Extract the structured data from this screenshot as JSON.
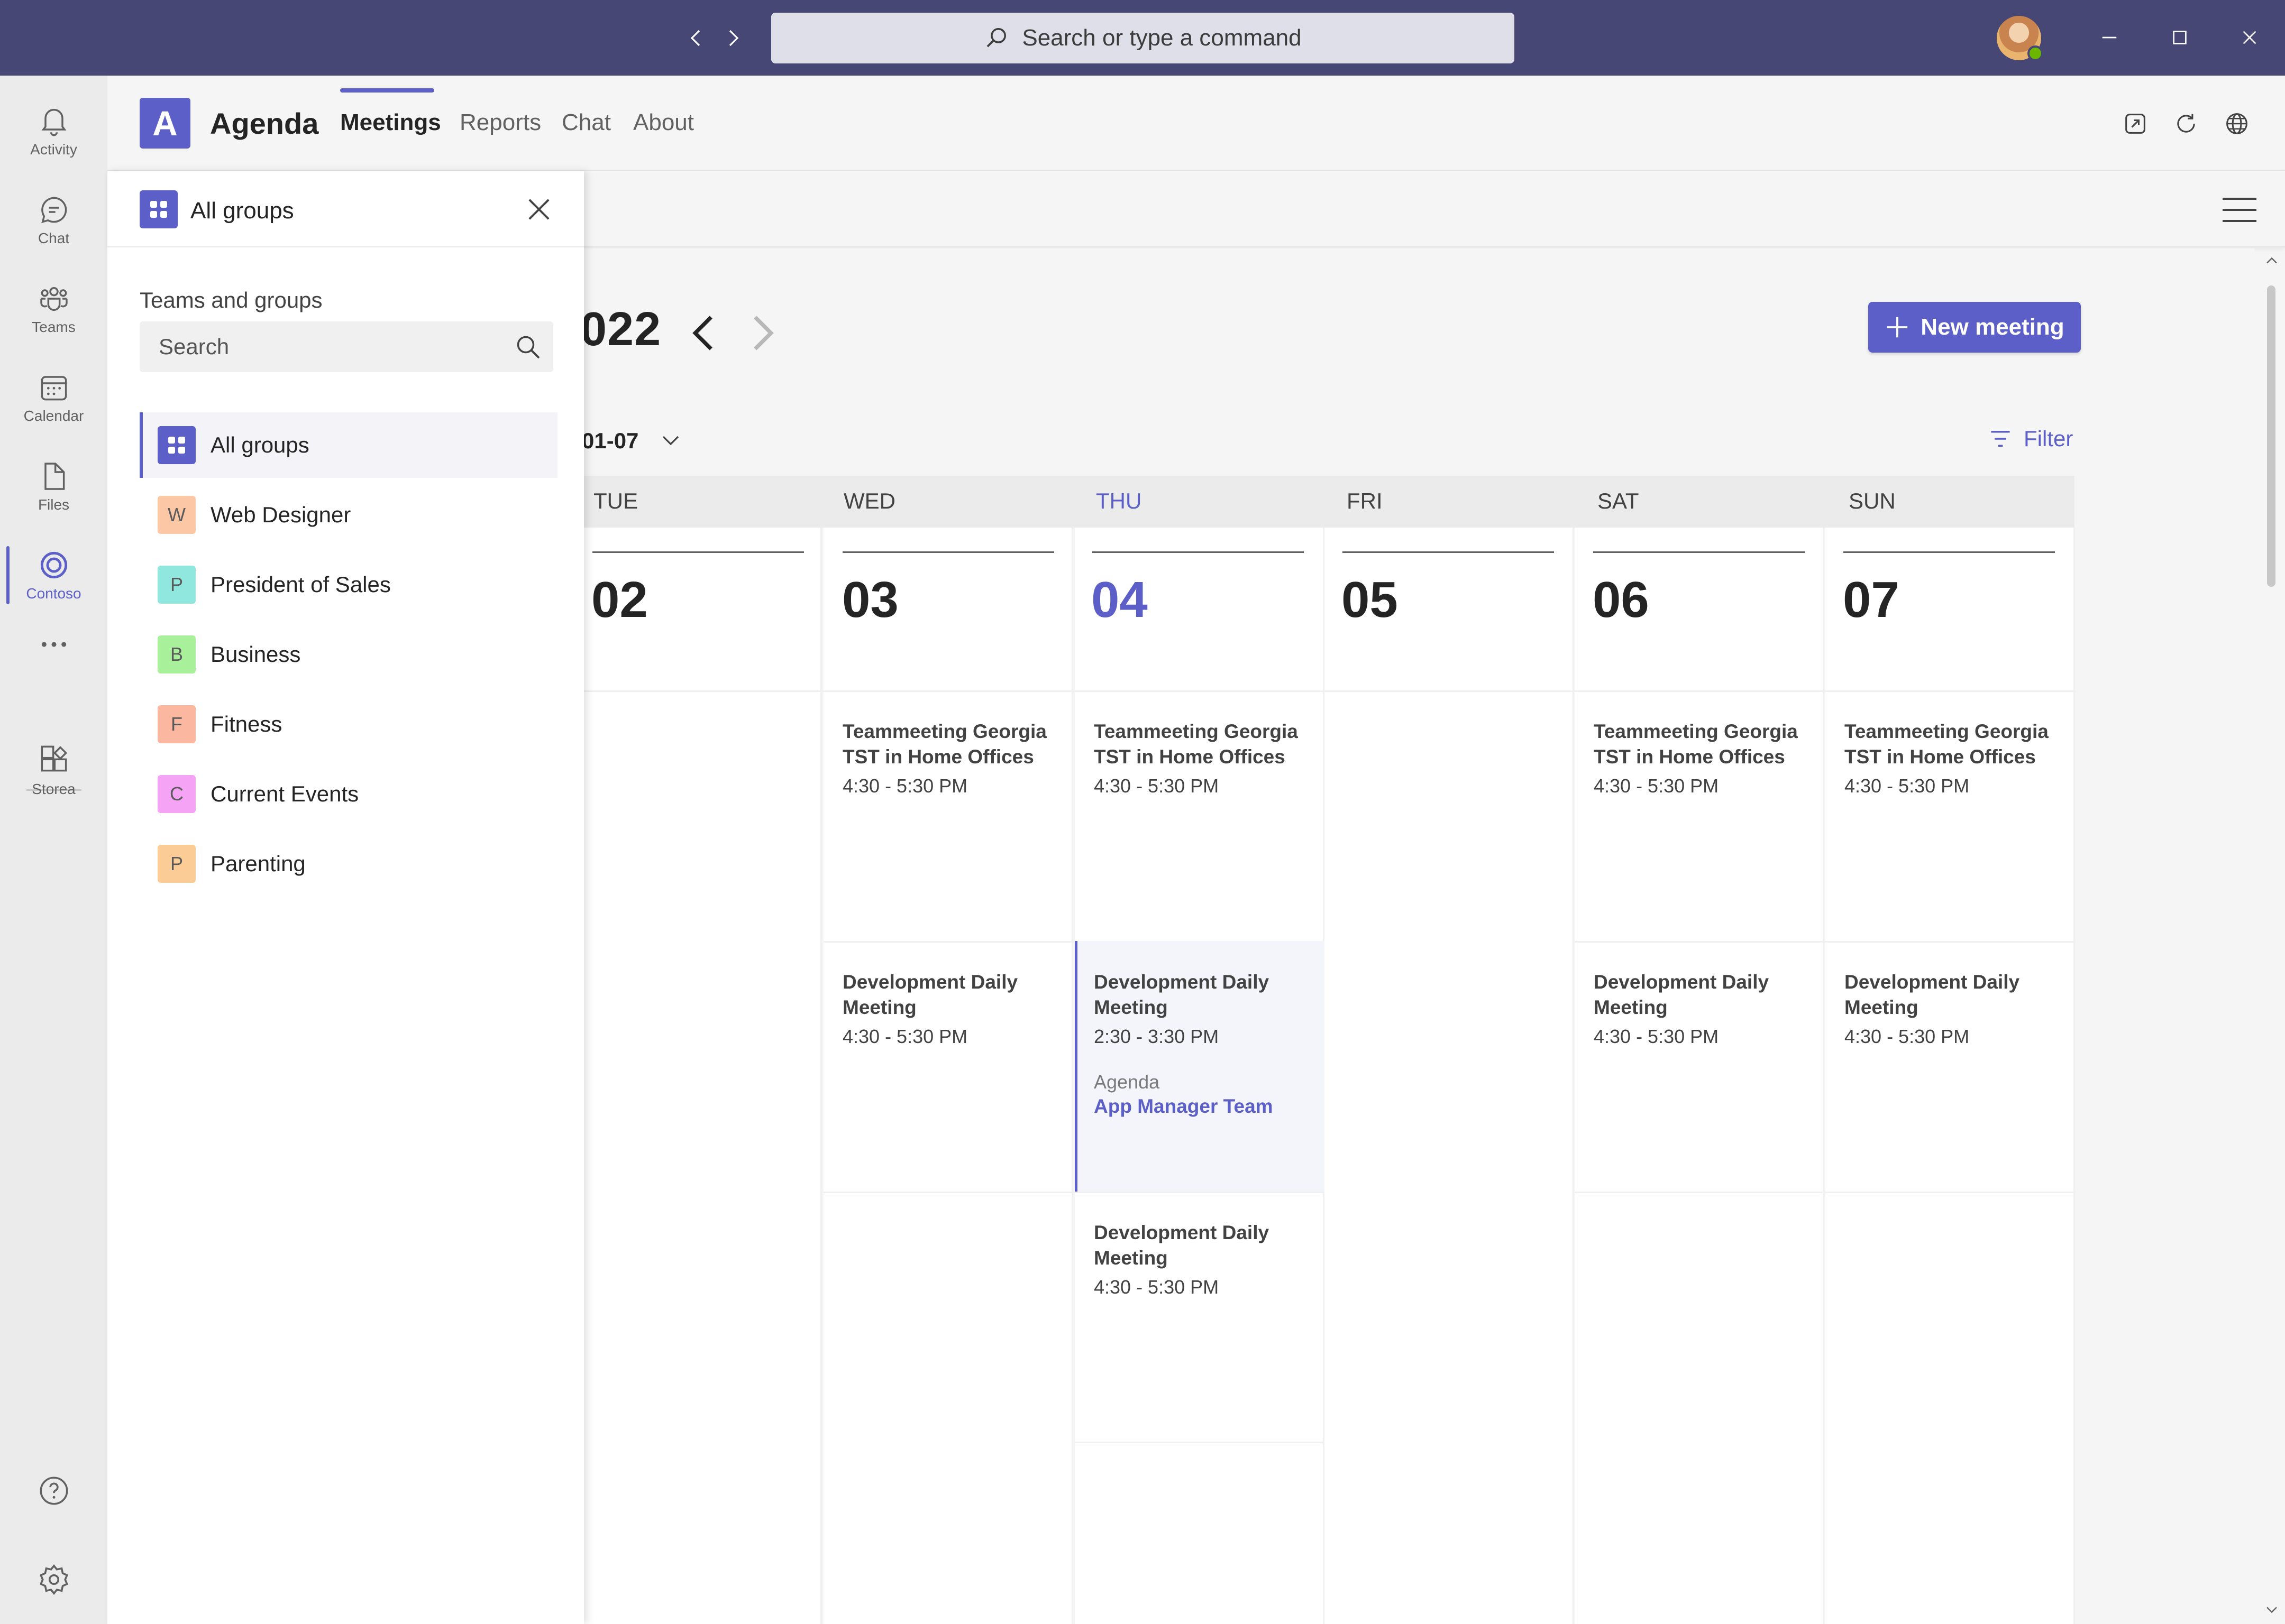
{
  "titlebar": {
    "search_placeholder": "Search or type a command",
    "icons": [
      "back-arrow-icon",
      "forward-arrow-icon",
      "search-icon",
      "minimize-icon",
      "maximize-icon",
      "close-icon"
    ]
  },
  "rail": {
    "items": [
      {
        "label": "Activity",
        "icon": "bell-icon"
      },
      {
        "label": "Chat",
        "icon": "chat-icon"
      },
      {
        "label": "Teams",
        "icon": "teams-icon"
      },
      {
        "label": "Calendar",
        "icon": "calendar-icon"
      },
      {
        "label": "Files",
        "icon": "file-icon"
      },
      {
        "label": "Contoso",
        "icon": "contoso-icon",
        "active": true
      },
      {
        "label": "",
        "icon": "more-icon"
      },
      {
        "label": "Storea",
        "icon": "store-icon"
      }
    ],
    "bottom": [
      "help-icon",
      "settings-icon"
    ]
  },
  "app": {
    "logo_letter": "A",
    "name": "Agenda",
    "tabs": [
      "Meetings",
      "Reports",
      "Chat",
      "About"
    ],
    "active_tab": "Meetings"
  },
  "calendar": {
    "month_title": "022",
    "range_label": "01-07",
    "new_meeting_label": "New meeting",
    "filter_label": "Filter",
    "days": [
      {
        "name": "TUE",
        "date": "02"
      },
      {
        "name": "WED",
        "date": "03"
      },
      {
        "name": "THU",
        "date": "04",
        "today": true
      },
      {
        "name": "FRI",
        "date": "05"
      },
      {
        "name": "SAT",
        "date": "06"
      },
      {
        "name": "SUN",
        "date": "07"
      }
    ],
    "events": {
      "teammeeting": {
        "title": "Teammeeting Georgia TST in Home Offices",
        "time": "4:30 - 5:30 PM"
      },
      "daily": {
        "title": "Development Daily Meeting",
        "time": "4:30 - 5:30 PM"
      },
      "selected": {
        "title": "Development Daily Meeting",
        "time": "2:30 - 3:30 PM",
        "category": "Agenda",
        "team": "App Manager Team"
      }
    }
  },
  "flyout": {
    "title": "All groups",
    "section_label": "Teams and groups",
    "search_placeholder": "Search",
    "groups": [
      {
        "name": "All groups",
        "active": true
      },
      {
        "name": "Web Designer",
        "letter": "W",
        "color": "#fcc7a5"
      },
      {
        "name": "President of Sales",
        "letter": "P",
        "color": "#8fe7de"
      },
      {
        "name": "Business",
        "letter": "B",
        "color": "#a8f09a"
      },
      {
        "name": "Fitness",
        "letter": "F",
        "color": "#fcb7a1"
      },
      {
        "name": "Current Events",
        "letter": "C",
        "color": "#f5a3f5"
      },
      {
        "name": "Parenting",
        "letter": "P",
        "color": "#fccc96"
      }
    ]
  }
}
